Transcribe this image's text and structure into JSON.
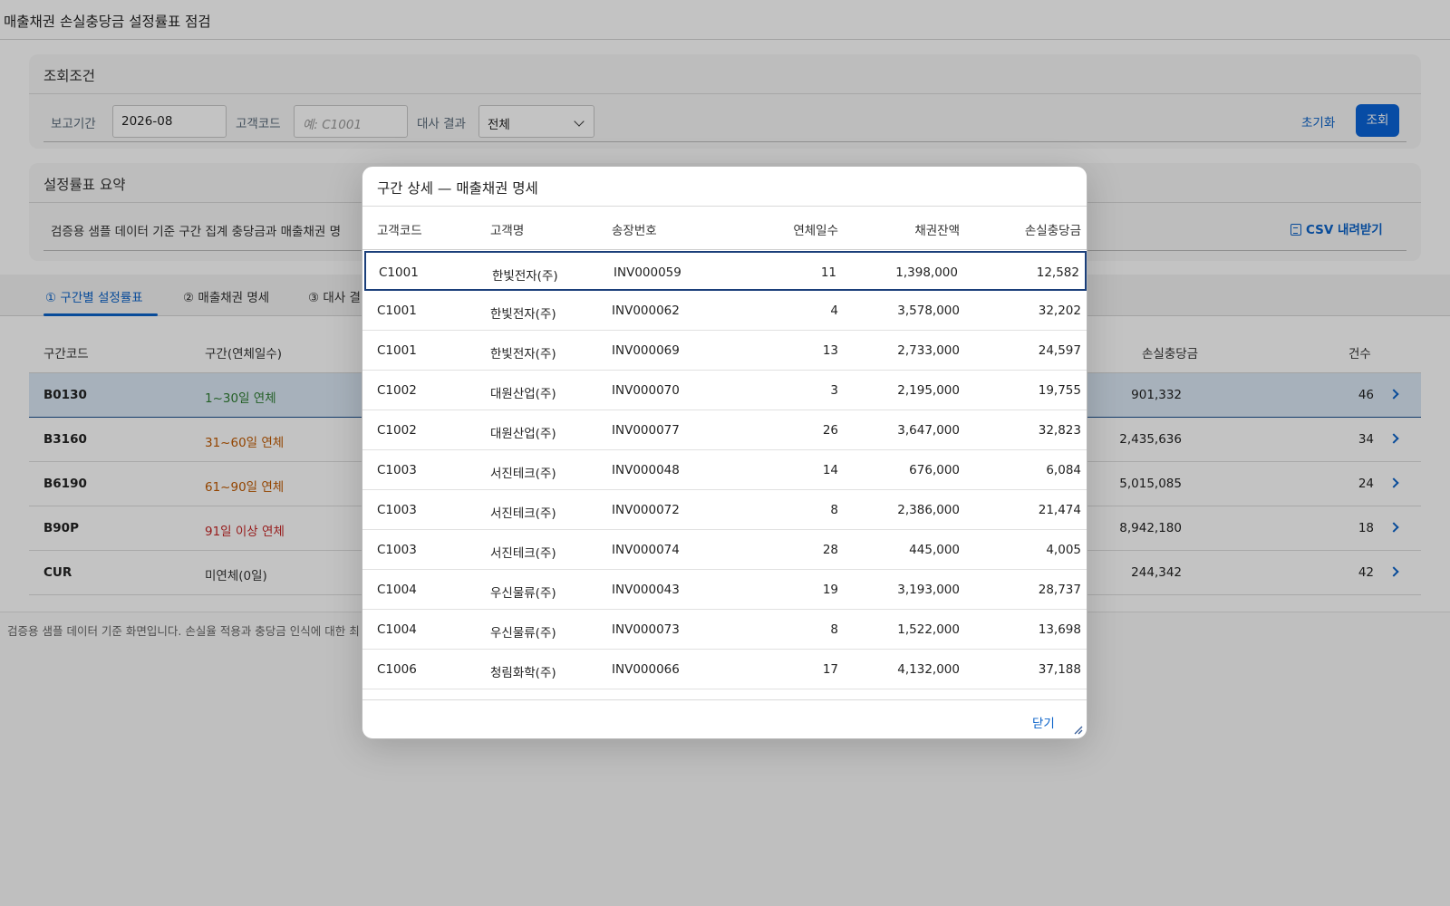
{
  "app": {
    "title": "매출채권 손실충당금 설정률표 점검"
  },
  "search": {
    "title": "조회조건",
    "period_label": "보고기간",
    "period_value": "2026-08",
    "customer_label": "고객코드",
    "customer_placeholder": "예: C1001",
    "recon_label": "대사 결과",
    "recon_value": "전체",
    "reset_label": "초기화",
    "search_label": "조회"
  },
  "summary": {
    "title": "설정률표 요약",
    "text": "검증용 샘플 데이터 기준 구간 집계 충당금과 매출채권 명",
    "csv_label": "CSV 내려받기"
  },
  "tabs": [
    {
      "label": "① 구간별 설정률표"
    },
    {
      "label": "② 매출채권 명세"
    },
    {
      "label": "③ 대사 결"
    }
  ],
  "bucket_table": {
    "headers": {
      "code": "구간코드",
      "range": "구간(연체일수)",
      "allowance": "손실충당금",
      "count": "건수"
    },
    "rows": [
      {
        "code": "B0130",
        "range": "1~30일 연체",
        "allowance": "901,332",
        "count": "46",
        "color": "#2e7d32"
      },
      {
        "code": "B3160",
        "range": "31~60일 연체",
        "allowance": "2,435,636",
        "count": "34",
        "color": "#c05a00"
      },
      {
        "code": "B6190",
        "range": "61~90일 연체",
        "allowance": "5,015,085",
        "count": "24",
        "color": "#c05a00"
      },
      {
        "code": "B90P",
        "range": "91일 이상 연체",
        "allowance": "8,942,180",
        "count": "18",
        "color": "#c62828"
      },
      {
        "code": "CUR",
        "range": "미연체(0일)",
        "allowance": "244,342",
        "count": "42",
        "color": "#333333"
      }
    ]
  },
  "footer": {
    "note": "검증용 샘플 데이터 기준 화면입니다. 손실율 적용과 충당금 인식에 대한 최"
  },
  "modal": {
    "title": "구간 상세 — 매출채권 명세",
    "headers": {
      "cust_code": "고객코드",
      "cust_name": "고객명",
      "invoice": "송장번호",
      "days": "연체일수",
      "balance": "채권잔액",
      "allowance": "손실충당금"
    },
    "rows": [
      {
        "cust_code": "C1001",
        "cust_name": "한빛전자(주)",
        "invoice": "INV000059",
        "days": "11",
        "balance": "1,398,000",
        "allowance": "12,582"
      },
      {
        "cust_code": "C1001",
        "cust_name": "한빛전자(주)",
        "invoice": "INV000062",
        "days": "4",
        "balance": "3,578,000",
        "allowance": "32,202"
      },
      {
        "cust_code": "C1001",
        "cust_name": "한빛전자(주)",
        "invoice": "INV000069",
        "days": "13",
        "balance": "2,733,000",
        "allowance": "24,597"
      },
      {
        "cust_code": "C1002",
        "cust_name": "대원산업(주)",
        "invoice": "INV000070",
        "days": "3",
        "balance": "2,195,000",
        "allowance": "19,755"
      },
      {
        "cust_code": "C1002",
        "cust_name": "대원산업(주)",
        "invoice": "INV000077",
        "days": "26",
        "balance": "3,647,000",
        "allowance": "32,823"
      },
      {
        "cust_code": "C1003",
        "cust_name": "서진테크(주)",
        "invoice": "INV000048",
        "days": "14",
        "balance": "676,000",
        "allowance": "6,084"
      },
      {
        "cust_code": "C1003",
        "cust_name": "서진테크(주)",
        "invoice": "INV000072",
        "days": "8",
        "balance": "2,386,000",
        "allowance": "21,474"
      },
      {
        "cust_code": "C1003",
        "cust_name": "서진테크(주)",
        "invoice": "INV000074",
        "days": "28",
        "balance": "445,000",
        "allowance": "4,005"
      },
      {
        "cust_code": "C1004",
        "cust_name": "우신물류(주)",
        "invoice": "INV000043",
        "days": "19",
        "balance": "3,193,000",
        "allowance": "28,737"
      },
      {
        "cust_code": "C1004",
        "cust_name": "우신물류(주)",
        "invoice": "INV000073",
        "days": "8",
        "balance": "1,522,000",
        "allowance": "13,698"
      },
      {
        "cust_code": "C1006",
        "cust_name": "청림화학(주)",
        "invoice": "INV000066",
        "days": "17",
        "balance": "4,132,000",
        "allowance": "37,188"
      }
    ],
    "close_label": "닫기"
  }
}
